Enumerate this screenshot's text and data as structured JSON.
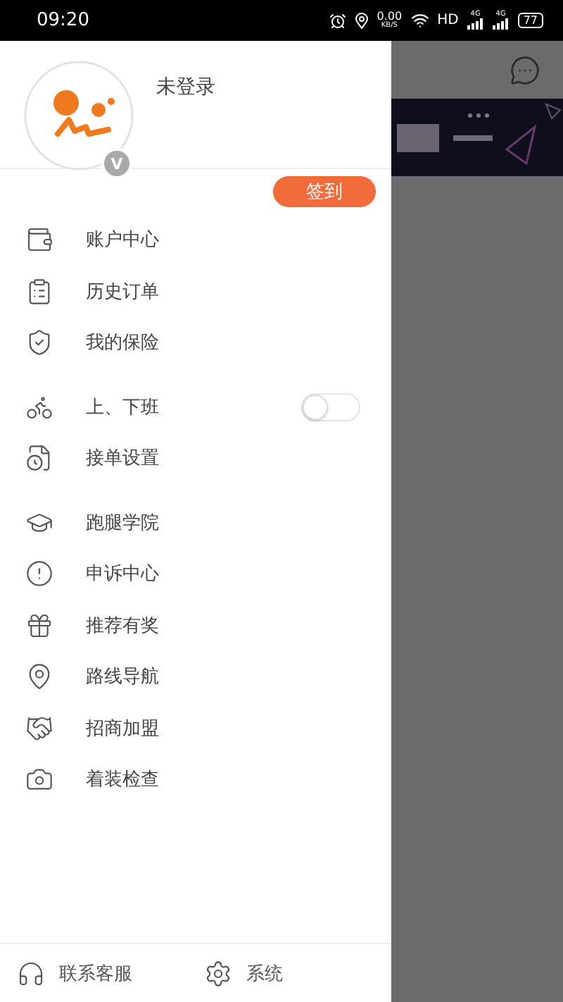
{
  "status_bar": {
    "time": "09:20",
    "net_speed": "0.00",
    "net_unit": "KB/S",
    "hd": "HD",
    "signals": [
      "4G",
      "4G"
    ],
    "battery": "77"
  },
  "profile": {
    "avatar_badge": "V",
    "name": "未登录",
    "sign_in_button": "签到"
  },
  "menu_groups": [
    {
      "items": [
        {
          "kind": "link",
          "label": "账户中心"
        },
        {
          "kind": "link",
          "label": "历史订单"
        },
        {
          "kind": "link",
          "label": "我的保险"
        }
      ]
    },
    {
      "items": [
        {
          "kind": "toggle",
          "label": "上、下班",
          "on": false
        },
        {
          "kind": "link",
          "label": "接单设置"
        }
      ]
    },
    {
      "items": [
        {
          "kind": "link",
          "label": "跑腿学院"
        },
        {
          "kind": "link",
          "label": "申诉中心"
        },
        {
          "kind": "link",
          "label": "推荐有奖"
        },
        {
          "kind": "link",
          "label": "路线导航"
        },
        {
          "kind": "link",
          "label": "招商加盟"
        },
        {
          "kind": "link",
          "label": "着装检查"
        }
      ]
    }
  ],
  "footer": [
    {
      "label": "联系客服"
    },
    {
      "label": "系统"
    }
  ]
}
